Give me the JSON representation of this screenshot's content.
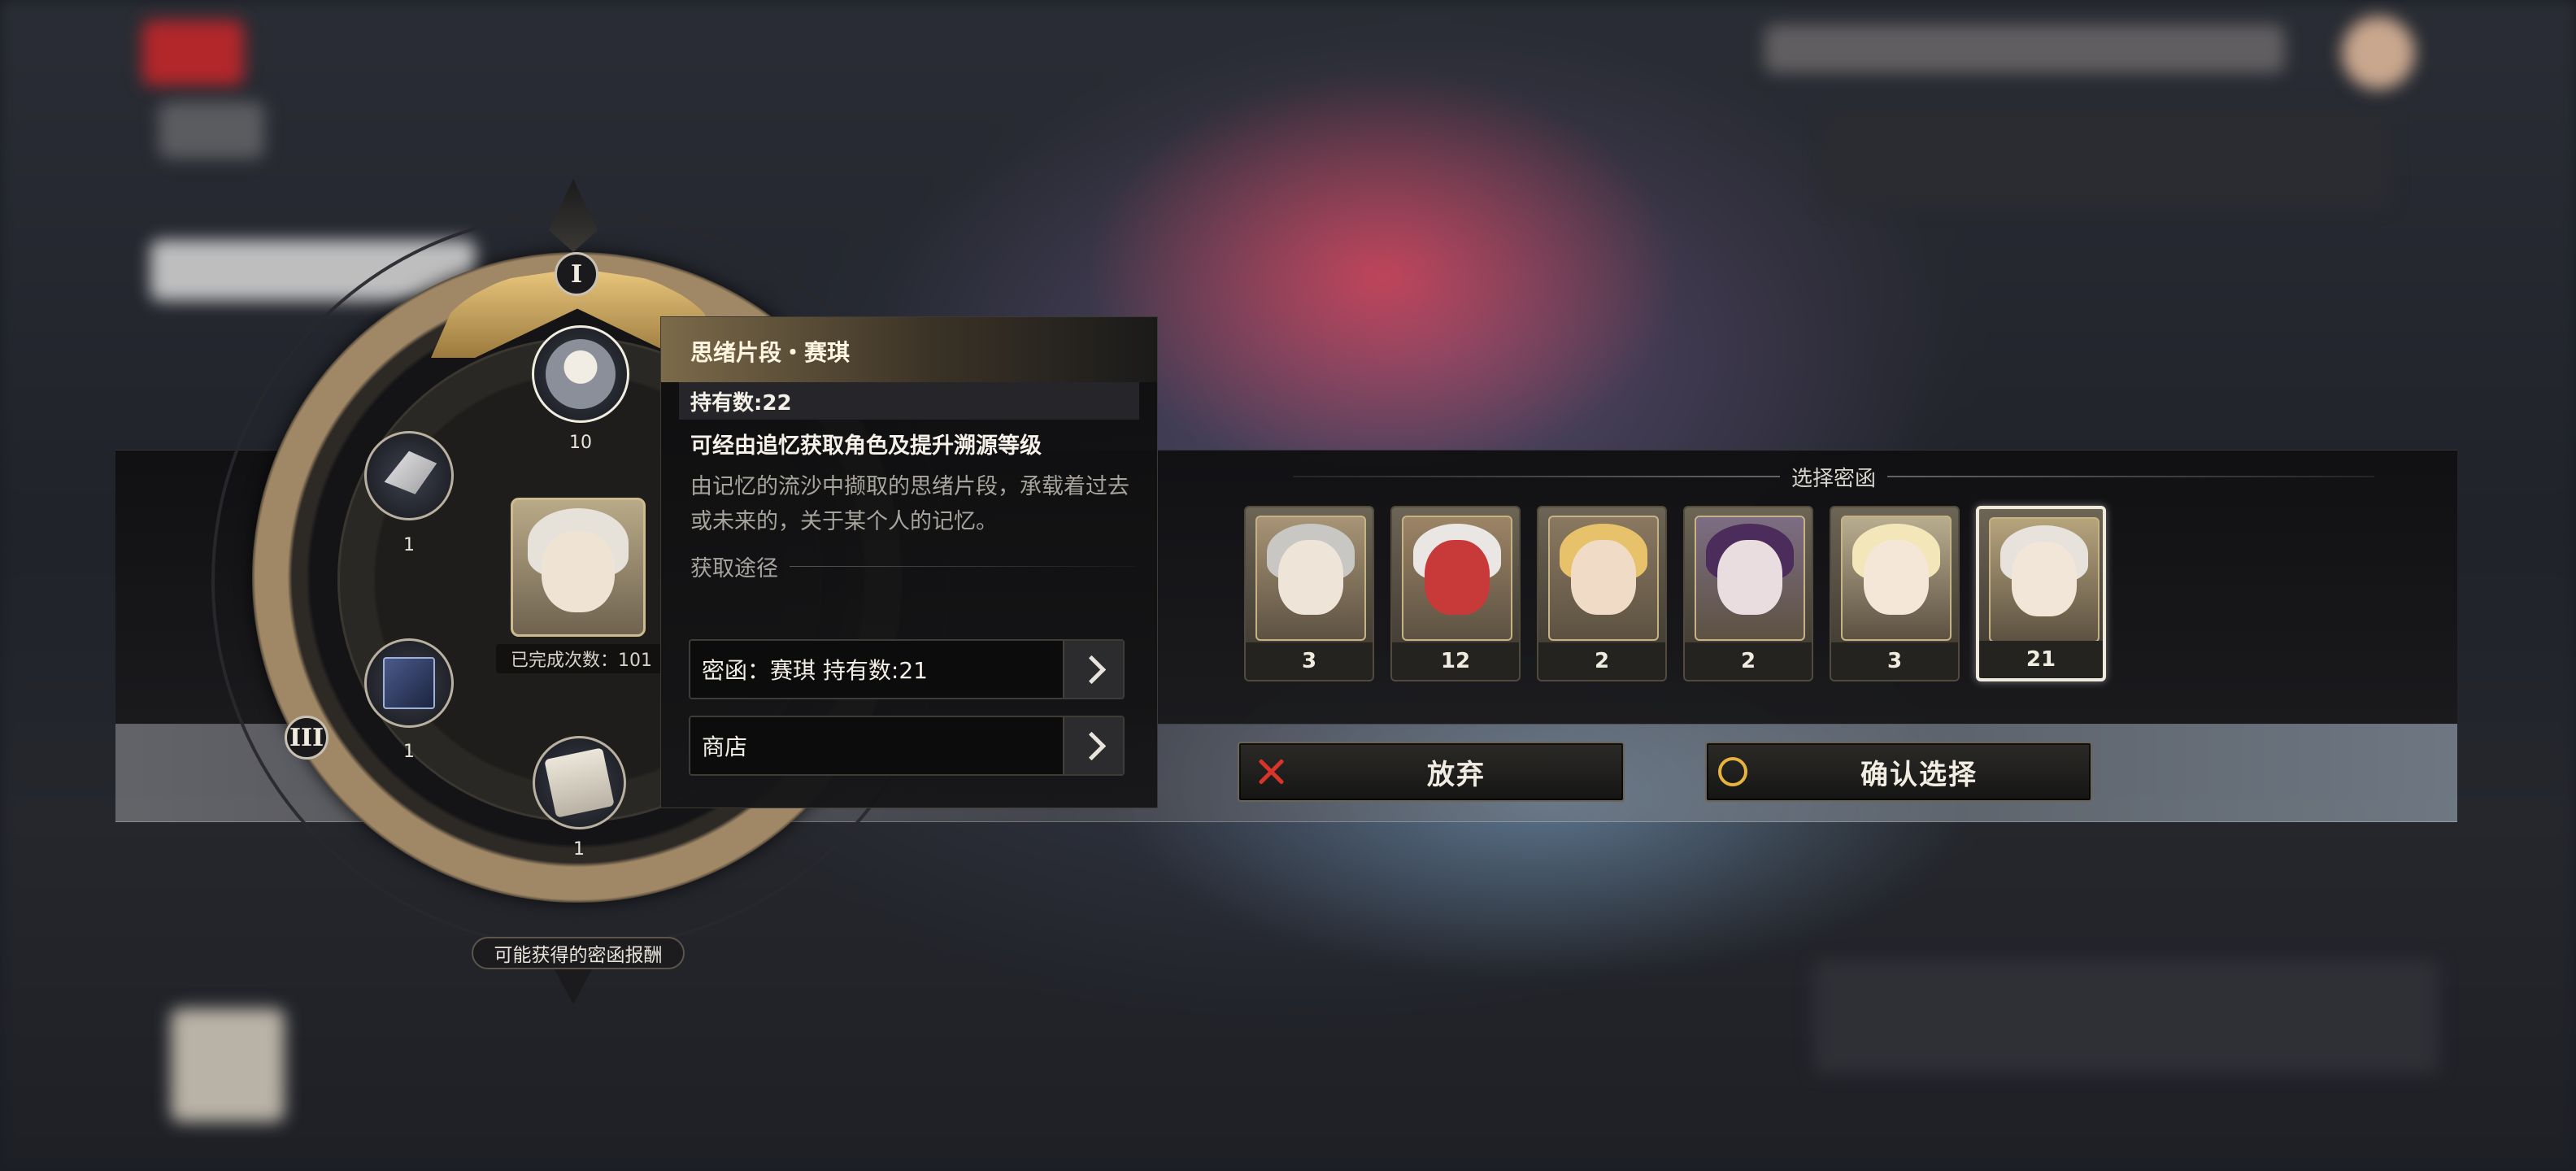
{
  "tooltip": {
    "title": "思绪片段・赛琪",
    "owned": "持有数:22",
    "subtitle": "可经由追忆获取角色及提升溯源等级",
    "description": "由记忆的流沙中撷取的思绪片段，承载着过去或未来的，关于某个人的记忆。",
    "source_heading": "获取途径",
    "sources": [
      {
        "label": "密函：赛琪 持有数:21"
      },
      {
        "label": "商店"
      }
    ]
  },
  "wheel": {
    "numeral_top": "I",
    "numeral_left": "III",
    "items": [
      {
        "name": "character-portrait",
        "count": "10"
      },
      {
        "name": "wing-item",
        "count": "1"
      },
      {
        "name": "book-item",
        "count": "1"
      },
      {
        "name": "scroll-item",
        "count": "1"
      }
    ],
    "completed_count": "已完成次数：101",
    "caption": "可能获得的密函报酬"
  },
  "selection": {
    "title": "选择密函",
    "cards": [
      {
        "count": "3",
        "hair": "#c9c7c4",
        "skin": "#efe4d8",
        "bg": "#a89476"
      },
      {
        "count": "12",
        "hair": "#e9e6e3",
        "skin": "#c8393a",
        "bg": "#9c8466"
      },
      {
        "count": "2",
        "hair": "#e8c26a",
        "skin": "#f0dcc6",
        "bg": "#8a7860"
      },
      {
        "count": "2",
        "hair": "#4b2c5a",
        "skin": "#eadde0",
        "bg": "#7d6d84"
      },
      {
        "count": "3",
        "hair": "#f3e6b8",
        "skin": "#f5e7d8",
        "bg": "#b9ad90"
      },
      {
        "count": "21",
        "hair": "#e7e3dc",
        "skin": "#f1e6d8",
        "bg": "#b6a47c",
        "selected": true
      }
    ],
    "abandon_label": "放弃",
    "confirm_label": "确认选择"
  },
  "colors": {
    "accent_gold": "#c9a55e",
    "cancel_red": "#d9342c",
    "confirm_yellow": "#e7b33c"
  }
}
